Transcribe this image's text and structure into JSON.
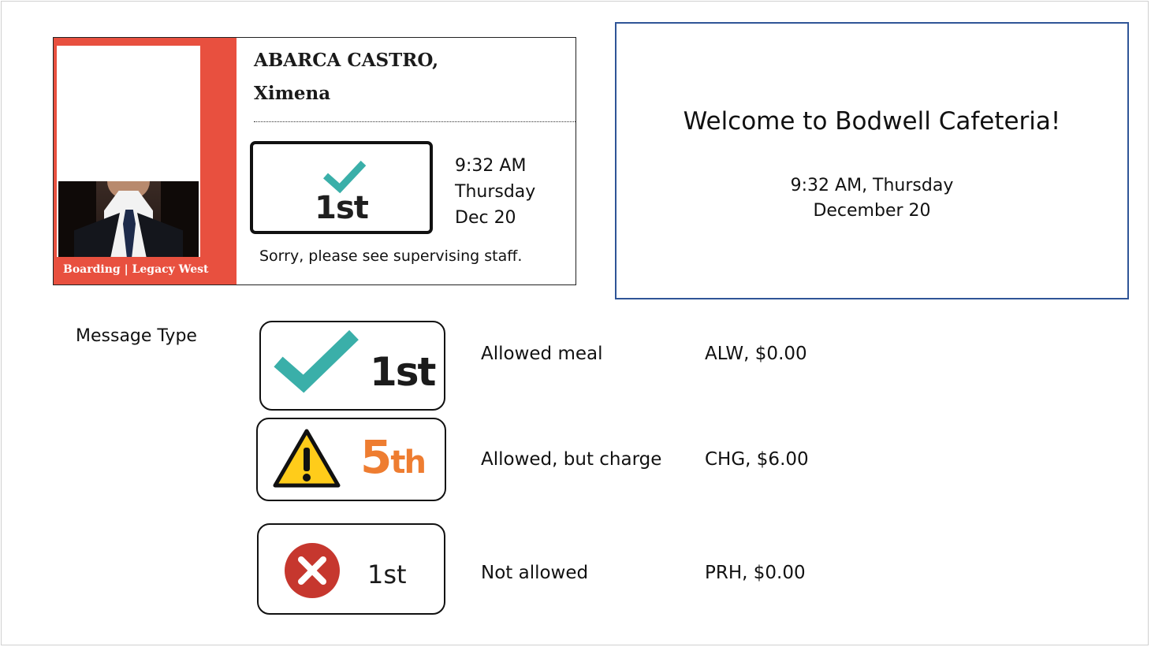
{
  "student_card": {
    "name_line1": "ABARCA CASTRO,",
    "name_line2": "Ximena",
    "program_label": "Boarding | Legacy West",
    "status_count": "1st",
    "time": "9:32 AM",
    "weekday": "Thursday",
    "date": "Dec 20",
    "message": "Sorry, please see supervising staff.",
    "side_color": "#e8503f"
  },
  "welcome": {
    "title": "Welcome to Bodwell Cafeteria!",
    "time_line": "9:32 AM, Thursday",
    "date_line": "December 20",
    "border_color": "#2f5597"
  },
  "legend": {
    "heading": "Message Type",
    "rows": [
      {
        "icon": "checkmark-icon",
        "count": "1st",
        "description": "Allowed meal",
        "code": "ALW, $0.00",
        "color": "#3aafa9"
      },
      {
        "icon": "warning-icon",
        "count_num": "5",
        "count_suffix": "th",
        "description": "Allowed, but charge",
        "code": "CHG, $6.00",
        "color": "#ee7d31"
      },
      {
        "icon": "denied-x-icon",
        "count": "1st",
        "description": "Not allowed",
        "code": "PRH, $0.00",
        "color": "#d13438"
      }
    ]
  }
}
